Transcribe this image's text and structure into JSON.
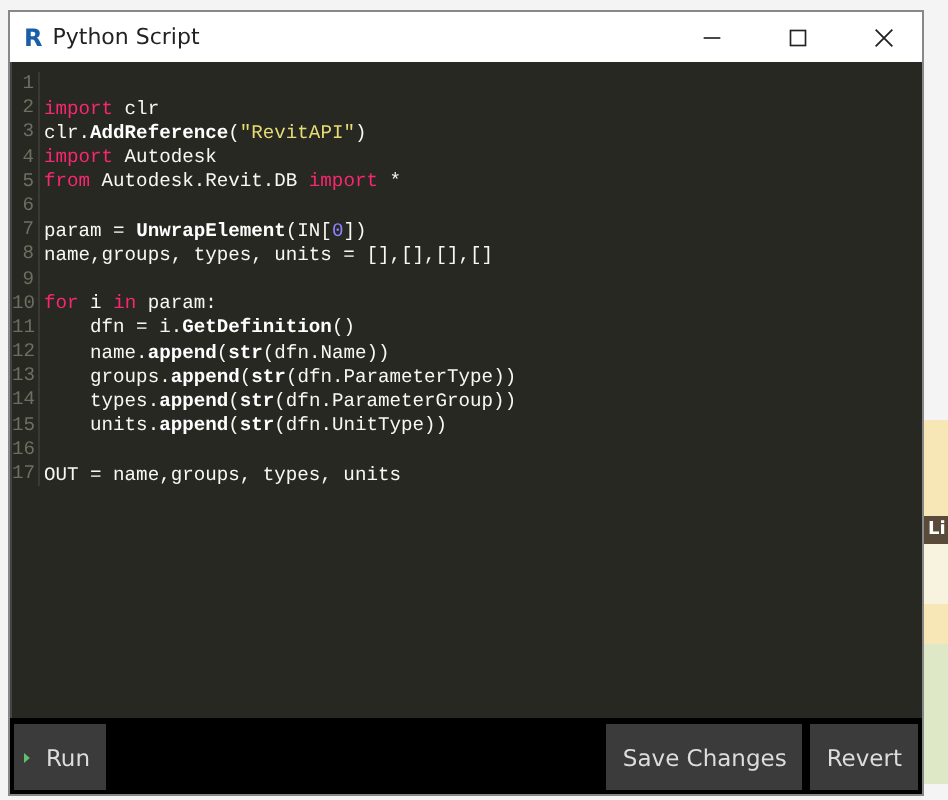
{
  "window": {
    "icon_letter": "R",
    "title": "Python Script"
  },
  "editor": {
    "lines": [
      {
        "number": "1"
      },
      {
        "number": "2",
        "tokens": [
          {
            "kind": "keyword",
            "text": "import"
          },
          {
            "kind": "plain",
            "text": " clr"
          }
        ]
      },
      {
        "number": "3",
        "tokens": [
          {
            "kind": "plain",
            "text": "clr."
          },
          {
            "kind": "function",
            "text": "AddReference"
          },
          {
            "kind": "plain",
            "text": "("
          },
          {
            "kind": "string",
            "text": "\"RevitAPI\""
          },
          {
            "kind": "plain",
            "text": ")"
          }
        ]
      },
      {
        "number": "4",
        "tokens": [
          {
            "kind": "keyword",
            "text": "import"
          },
          {
            "kind": "plain",
            "text": " Autodesk"
          }
        ]
      },
      {
        "number": "5",
        "tokens": [
          {
            "kind": "keyword",
            "text": "from"
          },
          {
            "kind": "plain",
            "text": " Autodesk.Revit.DB "
          },
          {
            "kind": "keyword",
            "text": "import"
          },
          {
            "kind": "plain",
            "text": " *"
          }
        ]
      },
      {
        "number": "6"
      },
      {
        "number": "7",
        "tokens": [
          {
            "kind": "plain",
            "text": "param = "
          },
          {
            "kind": "function",
            "text": "UnwrapElement"
          },
          {
            "kind": "plain",
            "text": "(IN["
          },
          {
            "kind": "number",
            "text": "0"
          },
          {
            "kind": "plain",
            "text": "])"
          }
        ]
      },
      {
        "number": "8",
        "tokens": [
          {
            "kind": "plain",
            "text": "name,groups, types, units = [],[],[],[]"
          }
        ]
      },
      {
        "number": "9"
      },
      {
        "number": "10",
        "tokens": [
          {
            "kind": "keyword",
            "text": "for"
          },
          {
            "kind": "plain",
            "text": " i "
          },
          {
            "kind": "keyword",
            "text": "in"
          },
          {
            "kind": "plain",
            "text": " param:"
          }
        ]
      },
      {
        "number": "11",
        "tokens": [
          {
            "kind": "plain",
            "text": "    dfn = i."
          },
          {
            "kind": "function",
            "text": "GetDefinition"
          },
          {
            "kind": "plain",
            "text": "()"
          }
        ]
      },
      {
        "number": "12",
        "tokens": [
          {
            "kind": "plain",
            "text": "    name."
          },
          {
            "kind": "function",
            "text": "append"
          },
          {
            "kind": "plain",
            "text": "("
          },
          {
            "kind": "function",
            "text": "str"
          },
          {
            "kind": "plain",
            "text": "(dfn.Name))"
          }
        ]
      },
      {
        "number": "13",
        "tokens": [
          {
            "kind": "plain",
            "text": "    groups."
          },
          {
            "kind": "function",
            "text": "append"
          },
          {
            "kind": "plain",
            "text": "("
          },
          {
            "kind": "function",
            "text": "str"
          },
          {
            "kind": "plain",
            "text": "(dfn.ParameterType))"
          }
        ]
      },
      {
        "number": "14",
        "tokens": [
          {
            "kind": "plain",
            "text": "    types."
          },
          {
            "kind": "function",
            "text": "append"
          },
          {
            "kind": "plain",
            "text": "("
          },
          {
            "kind": "function",
            "text": "str"
          },
          {
            "kind": "plain",
            "text": "(dfn.ParameterGroup))"
          }
        ]
      },
      {
        "number": "15",
        "tokens": [
          {
            "kind": "plain",
            "text": "    units."
          },
          {
            "kind": "function",
            "text": "append"
          },
          {
            "kind": "plain",
            "text": "("
          },
          {
            "kind": "function",
            "text": "str"
          },
          {
            "kind": "plain",
            "text": "(dfn.UnitType))"
          }
        ]
      },
      {
        "number": "16"
      },
      {
        "number": "17",
        "tokens": [
          {
            "kind": "plain",
            "text": "OUT = name,groups, types, units"
          }
        ]
      }
    ]
  },
  "buttons": {
    "run": "Run",
    "save": "Save Changes",
    "revert": "Revert"
  },
  "background": {
    "label": "Li"
  }
}
